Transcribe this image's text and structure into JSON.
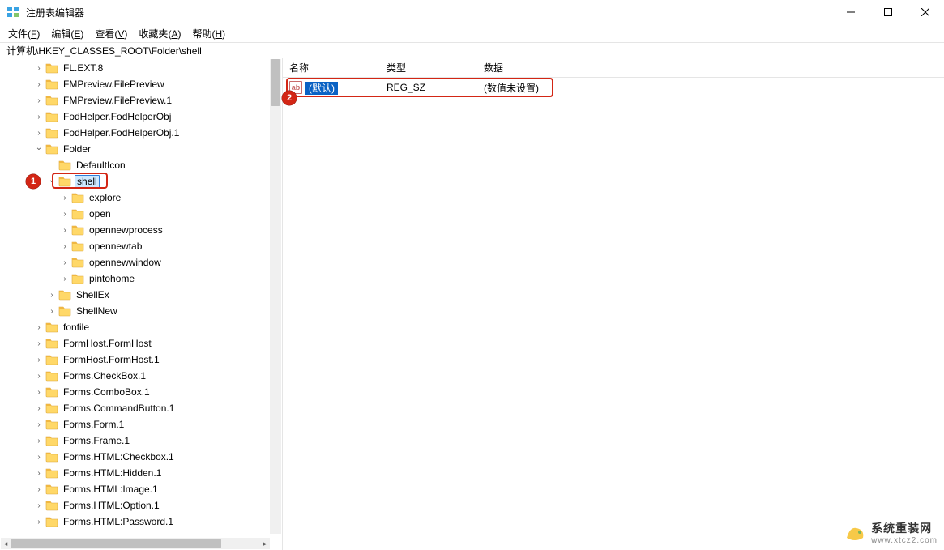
{
  "window": {
    "title": "注册表编辑器"
  },
  "menu": {
    "file": {
      "label": "文件",
      "mnemonic": "F"
    },
    "edit": {
      "label": "编辑",
      "mnemonic": "E"
    },
    "view": {
      "label": "查看",
      "mnemonic": "V"
    },
    "fav": {
      "label": "收藏夹",
      "mnemonic": "A"
    },
    "help": {
      "label": "帮助",
      "mnemonic": "H"
    }
  },
  "address": "计算机\\HKEY_CLASSES_ROOT\\Folder\\shell",
  "tree": [
    {
      "indent": 2,
      "exp": ">",
      "label": "FL.EXT.8"
    },
    {
      "indent": 2,
      "exp": ">",
      "label": "FMPreview.FilePreview"
    },
    {
      "indent": 2,
      "exp": ">",
      "label": "FMPreview.FilePreview.1"
    },
    {
      "indent": 2,
      "exp": ">",
      "label": "FodHelper.FodHelperObj"
    },
    {
      "indent": 2,
      "exp": ">",
      "label": "FodHelper.FodHelperObj.1"
    },
    {
      "indent": 2,
      "exp": "v",
      "label": "Folder"
    },
    {
      "indent": 3,
      "exp": "",
      "label": "DefaultIcon"
    },
    {
      "indent": 3,
      "exp": "v",
      "label": "shell",
      "selected": true
    },
    {
      "indent": 4,
      "exp": ">",
      "label": "explore"
    },
    {
      "indent": 4,
      "exp": ">",
      "label": "open"
    },
    {
      "indent": 4,
      "exp": ">",
      "label": "opennewprocess"
    },
    {
      "indent": 4,
      "exp": ">",
      "label": "opennewtab"
    },
    {
      "indent": 4,
      "exp": ">",
      "label": "opennewwindow"
    },
    {
      "indent": 4,
      "exp": ">",
      "label": "pintohome"
    },
    {
      "indent": 3,
      "exp": ">",
      "label": "ShellEx"
    },
    {
      "indent": 3,
      "exp": ">",
      "label": "ShellNew"
    },
    {
      "indent": 2,
      "exp": ">",
      "label": "fonfile"
    },
    {
      "indent": 2,
      "exp": ">",
      "label": "FormHost.FormHost"
    },
    {
      "indent": 2,
      "exp": ">",
      "label": "FormHost.FormHost.1"
    },
    {
      "indent": 2,
      "exp": ">",
      "label": "Forms.CheckBox.1"
    },
    {
      "indent": 2,
      "exp": ">",
      "label": "Forms.ComboBox.1"
    },
    {
      "indent": 2,
      "exp": ">",
      "label": "Forms.CommandButton.1"
    },
    {
      "indent": 2,
      "exp": ">",
      "label": "Forms.Form.1"
    },
    {
      "indent": 2,
      "exp": ">",
      "label": "Forms.Frame.1"
    },
    {
      "indent": 2,
      "exp": ">",
      "label": "Forms.HTML:Checkbox.1"
    },
    {
      "indent": 2,
      "exp": ">",
      "label": "Forms.HTML:Hidden.1"
    },
    {
      "indent": 2,
      "exp": ">",
      "label": "Forms.HTML:Image.1"
    },
    {
      "indent": 2,
      "exp": ">",
      "label": "Forms.HTML:Option.1"
    },
    {
      "indent": 2,
      "exp": ">",
      "label": "Forms.HTML:Password.1"
    }
  ],
  "columns": {
    "name": "名称",
    "type": "类型",
    "data": "数据"
  },
  "values": [
    {
      "icon": "ab",
      "name": "(默认)",
      "type": "REG_SZ",
      "data": "(数值未设置)"
    }
  ],
  "annotations": {
    "one": "1",
    "two": "2"
  },
  "watermark": {
    "cn": "系统重装网",
    "url": "www.xtcz2.com"
  }
}
